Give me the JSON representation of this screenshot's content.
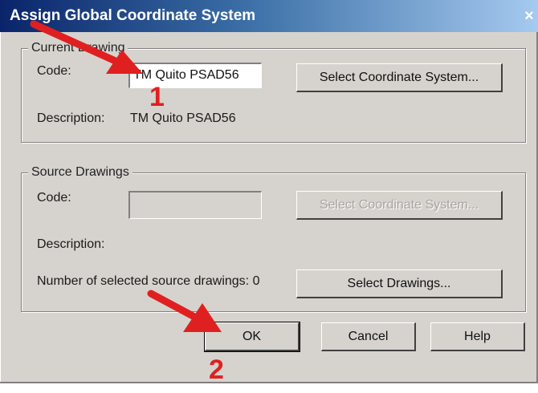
{
  "window": {
    "title": "Assign Global Coordinate System",
    "close_glyph": "×"
  },
  "current_drawing": {
    "group_label": "Current Drawing",
    "code_label": "Code:",
    "code_value": "TM Quito PSAD56",
    "select_button": "Select Coordinate System...",
    "description_label": "Description:",
    "description_value": "TM Quito PSAD56"
  },
  "source_drawings": {
    "group_label": "Source Drawings",
    "code_label": "Code:",
    "code_value": "",
    "select_button": "Select Coordinate System...",
    "select_button_state": "disabled",
    "description_label": "Description:",
    "description_value": "",
    "count_label": "Number of selected source drawings: 0",
    "select_drawings_button": "Select Drawings..."
  },
  "footer": {
    "ok": "OK",
    "cancel": "Cancel",
    "help": "Help"
  },
  "annotations": {
    "marker_1": "1",
    "marker_2": "2",
    "arrow_color": "#e02020"
  },
  "colors": {
    "dialog_bg": "#d6d3ce",
    "titlebar_start": "#0a246a",
    "titlebar_end": "#a6caf0"
  }
}
